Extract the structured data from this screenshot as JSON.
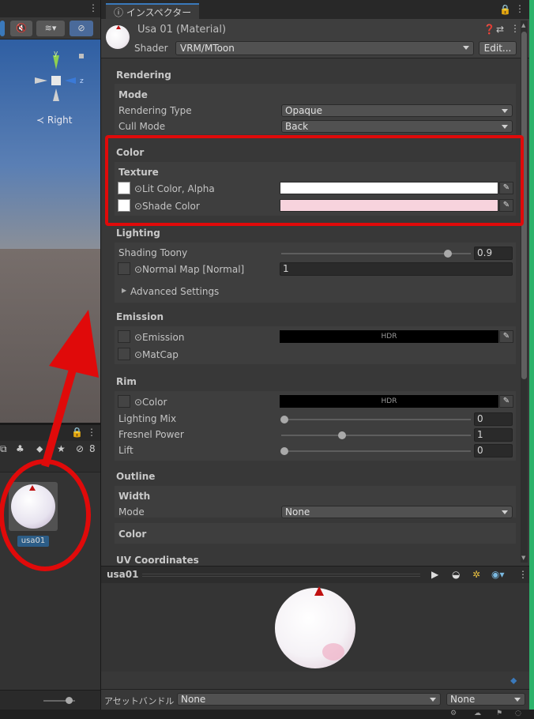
{
  "scene": {
    "axis_y": "y",
    "axis_z": "z",
    "view_label": "≺ Right"
  },
  "project": {
    "filter_count": "8",
    "asset_name": "usa01"
  },
  "inspector": {
    "tab_label": "ⓘ インスペクター",
    "material_title": "Usa 01 (Material)",
    "shader_label": "Shader",
    "shader_value": "VRM/MToon",
    "edit_label": "Edit...",
    "rendering": {
      "title": "Rendering",
      "mode_title": "Mode",
      "rendering_type_label": "Rendering Type",
      "rendering_type_value": "Opaque",
      "cull_mode_label": "Cull Mode",
      "cull_mode_value": "Back"
    },
    "color": {
      "title": "Color",
      "texture_title": "Texture",
      "lit_color_label": "⊙Lit Color, Alpha",
      "lit_color_hex": "#ffffff",
      "shade_color_label": "⊙Shade Color",
      "shade_color_hex": "#f7d3dd"
    },
    "lighting": {
      "title": "Lighting",
      "shading_toony_label": "Shading Toony",
      "shading_toony_value": "0.9",
      "normal_map_label": "⊙Normal Map [Normal]",
      "normal_map_value": "1",
      "advanced_label": "Advanced Settings"
    },
    "emission": {
      "title": "Emission",
      "emission_label": "⊙Emission",
      "hdr": "HDR",
      "matcap_label": "⊙MatCap"
    },
    "rim": {
      "title": "Rim",
      "color_label": "⊙Color",
      "hdr": "HDR",
      "lighting_mix_label": "Lighting Mix",
      "lighting_mix_value": "0",
      "fresnel_label": "Fresnel Power",
      "fresnel_value": "1",
      "lift_label": "Lift",
      "lift_value": "0"
    },
    "outline": {
      "title": "Outline",
      "width_title": "Width",
      "mode_label": "Mode",
      "mode_value": "None",
      "color_title": "Color"
    },
    "uv_title": "UV Coordinates",
    "preview_name": "usa01",
    "assetbundle_label": "アセットバンドル",
    "assetbundle_value": "None",
    "variant_value": "None"
  },
  "colors": {
    "highlight": "#e00a0a",
    "accent_edge": "#2db36b"
  }
}
